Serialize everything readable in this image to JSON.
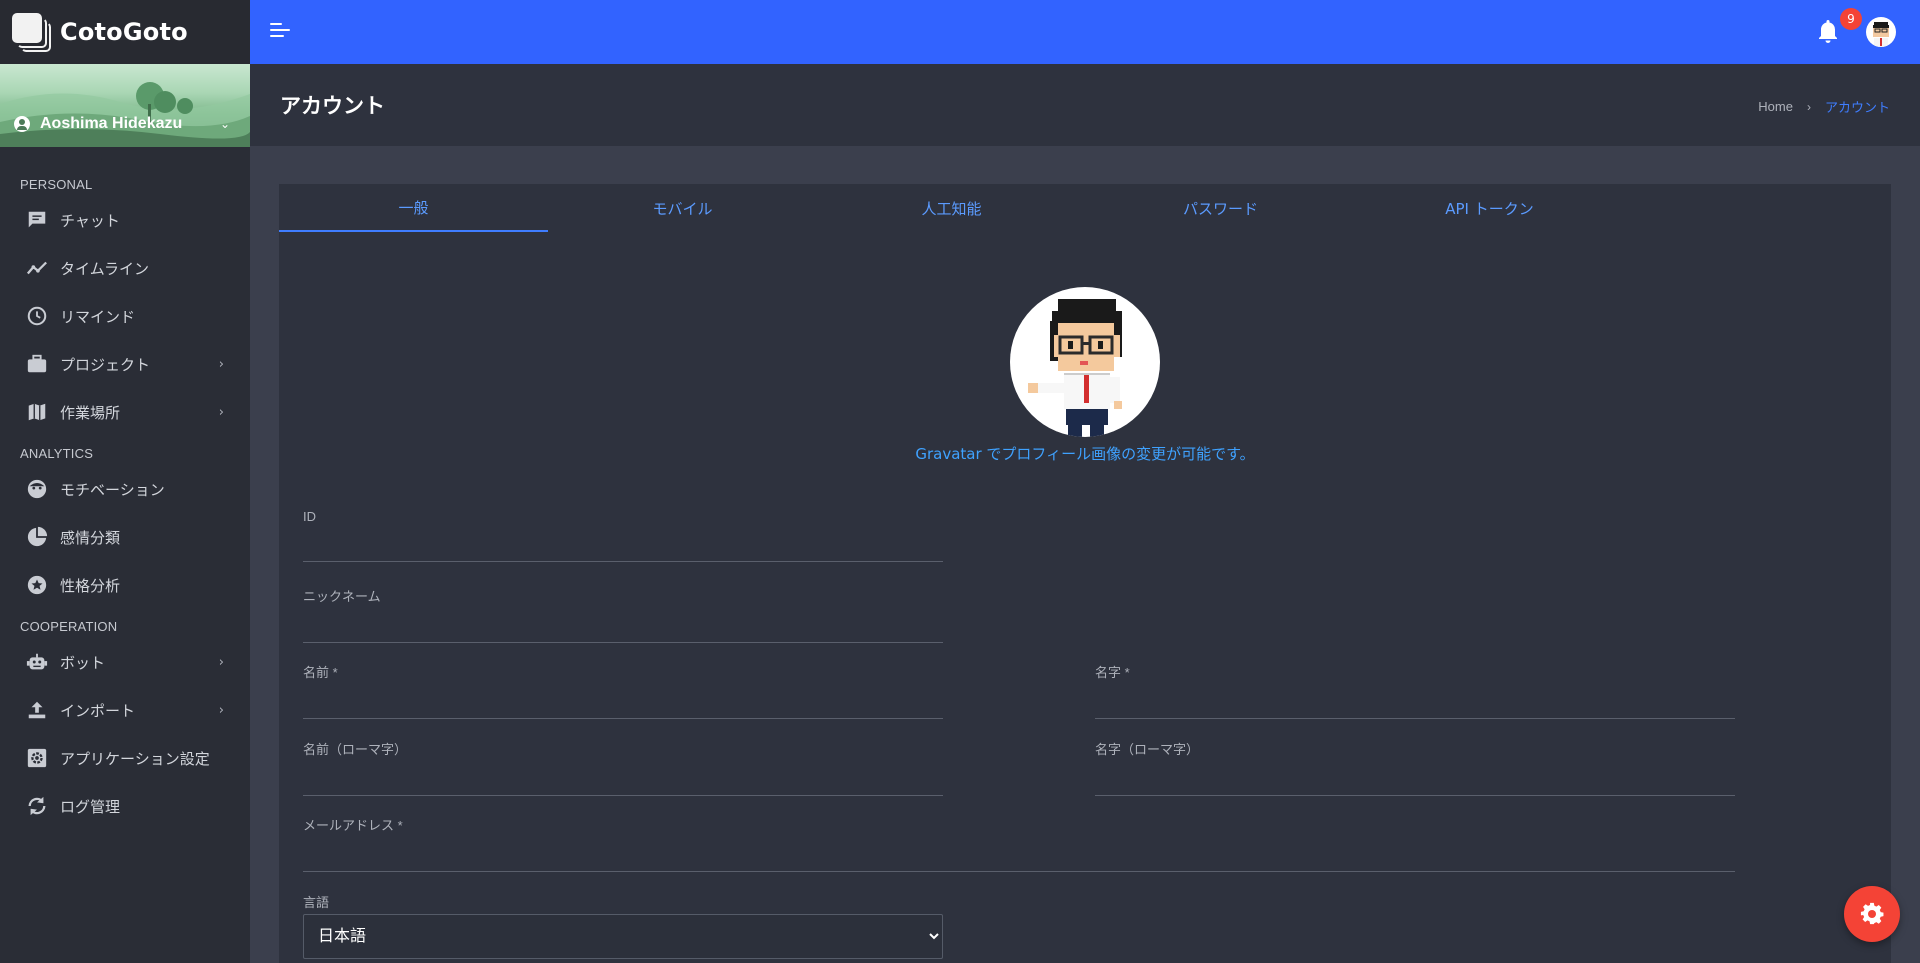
{
  "app": {
    "brand_name": "CotoGoto"
  },
  "user_panel": {
    "name": "Aoshima Hidekazu"
  },
  "sidebar": {
    "sections": [
      {
        "title": "PERSONAL",
        "items": [
          {
            "label": "チャット",
            "icon": "chat-icon",
            "has_submenu": false
          },
          {
            "label": "タイムライン",
            "icon": "timeline-icon",
            "has_submenu": false
          },
          {
            "label": "リマインド",
            "icon": "clock-icon",
            "has_submenu": false
          },
          {
            "label": "プロジェクト",
            "icon": "briefcase-icon",
            "has_submenu": true
          },
          {
            "label": "作業場所",
            "icon": "map-icon",
            "has_submenu": true
          }
        ]
      },
      {
        "title": "ANALYTICS",
        "items": [
          {
            "label": "モチベーション",
            "icon": "face-icon",
            "has_submenu": false
          },
          {
            "label": "感情分類",
            "icon": "pie-chart-icon",
            "has_submenu": false
          },
          {
            "label": "性格分析",
            "icon": "star-icon",
            "has_submenu": false
          }
        ]
      },
      {
        "title": "COOPERATION",
        "items": [
          {
            "label": "ボット",
            "icon": "robot-icon",
            "has_submenu": true
          },
          {
            "label": "インポート",
            "icon": "upload-icon",
            "has_submenu": true
          },
          {
            "label": "アプリケーション設定",
            "icon": "settings-box-icon",
            "has_submenu": false
          },
          {
            "label": "ログ管理",
            "icon": "sync-icon",
            "has_submenu": false
          }
        ]
      }
    ]
  },
  "topbar": {
    "notification_count": "9"
  },
  "header": {
    "title": "アカウント",
    "breadcrumb": {
      "home": "Home",
      "current": "アカウント"
    }
  },
  "tabs": [
    "一般",
    "モバイル",
    "人工知能",
    "パスワード",
    "API トークン"
  ],
  "profile": {
    "gravatar_note": "Gravatar でプロフィール画像の変更が可能です。"
  },
  "form": {
    "id_label": "ID",
    "id_value": "",
    "nickname_label": "ニックネーム",
    "nickname_value": "",
    "first_name_label": "名前 *",
    "first_name_value": "",
    "last_name_label": "名字 *",
    "last_name_value": "",
    "first_name_roman_label": "名前（ローマ字）",
    "first_name_roman_value": "",
    "last_name_roman_label": "名字（ローマ字）",
    "last_name_roman_value": "",
    "email_label": "メールアドレス *",
    "email_value": "",
    "language_label": "言語",
    "language_value": "日本語"
  },
  "colors": {
    "accent": "#3263ff",
    "fab": "#f44336",
    "link": "#3fa2ff"
  }
}
